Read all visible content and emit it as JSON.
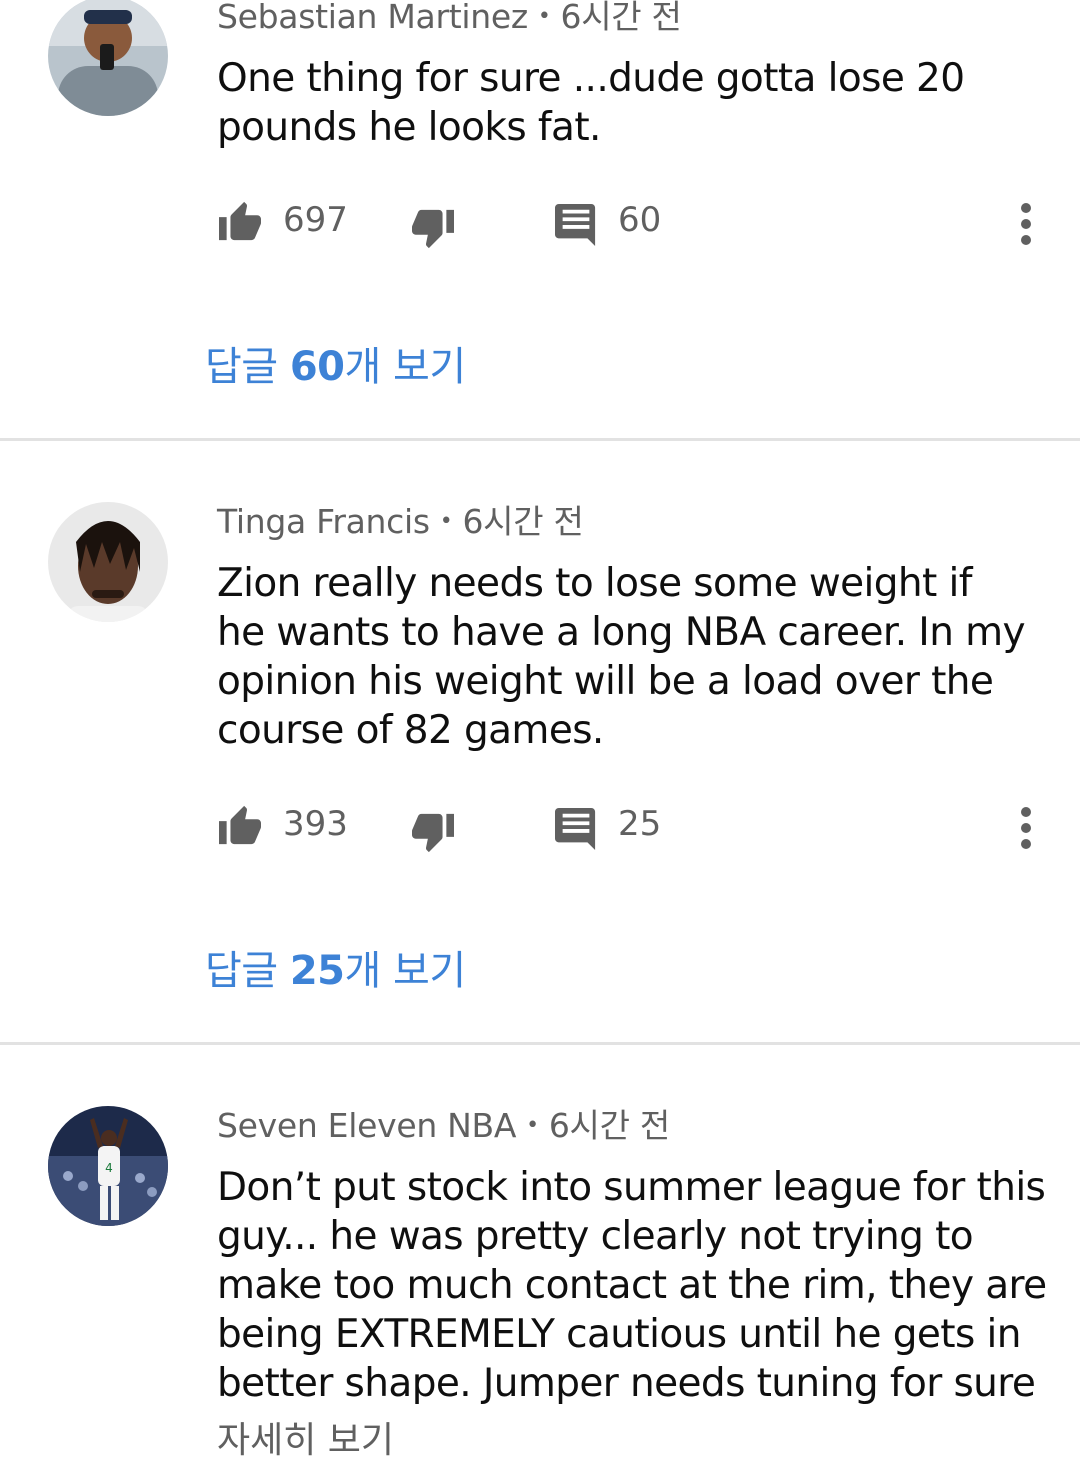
{
  "comments": [
    {
      "author": "Sebastian Martinez",
      "time": "6시간 전",
      "text_lines": [
        "One thing for sure ...dude gotta lose 20",
        "pounds he looks fat."
      ],
      "likes": "697",
      "reply_count": "60",
      "view_replies": {
        "prefix": "답글 ",
        "count": "60",
        "suffix": "개 보기"
      }
    },
    {
      "author": "Tinga Francis",
      "time": "6시간 전",
      "text_lines": [
        "Zion really needs to lose some weight if",
        "he wants to have a long NBA career. In my",
        "opinion his weight will be a load over the",
        "course of 82 games."
      ],
      "likes": "393",
      "reply_count": "25",
      "view_replies": {
        "prefix": "답글 ",
        "count": "25",
        "suffix": "개 보기"
      }
    },
    {
      "author": "Seven Eleven NBA",
      "time": "6시간 전",
      "text_lines": [
        "Don’t put stock into summer league for this",
        "guy... he was pretty clearly not trying to",
        "make too much contact at the rim, they are",
        "being EXTREMELY cautious until he gets in",
        "better shape. Jumper needs tuning for sure"
      ],
      "read_more": "자세히 보기"
    }
  ],
  "colors": {
    "link": "#3d82d6",
    "meta": "#606060",
    "divider": "#e2e2e2"
  },
  "icons": [
    "thumb-up-icon",
    "thumb-down-icon",
    "comment-icon",
    "more-vert-icon"
  ]
}
